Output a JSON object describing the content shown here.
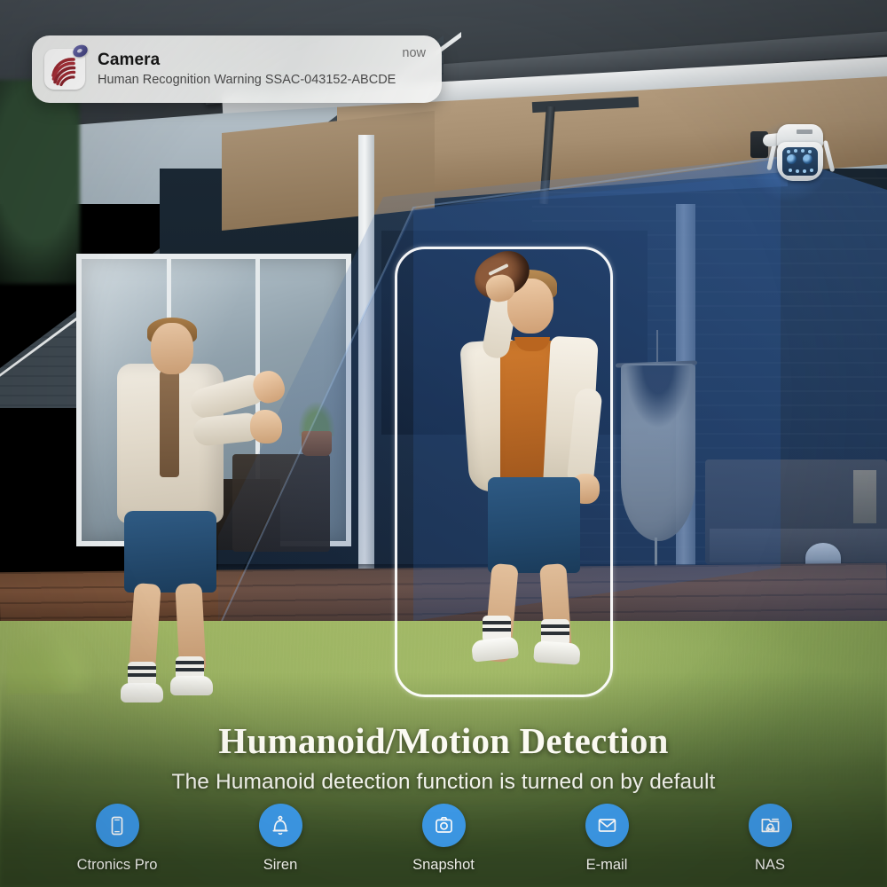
{
  "notification": {
    "app_icon": "camera-app-icon",
    "badge_icon": "shield-badge-icon",
    "title": "Camera",
    "message": "Human Recognition Warning SSAC-043152-ABCDE",
    "time": "now"
  },
  "scene": {
    "camera_device": "ptz-security-camera",
    "detection_box": "humanoid-detection-bounding-box",
    "detection_cone": "camera-field-of-view-cone",
    "subject_left": "person-catching",
    "subject_right": "person-throwing-football"
  },
  "headline": {
    "title": "Humanoid/Motion Detection",
    "subtitle": "The Humanoid detection function is turned on by default"
  },
  "features": [
    {
      "label": "Ctronics Pro",
      "icon": "smartphone-icon"
    },
    {
      "label": "Siren",
      "icon": "bell-icon"
    },
    {
      "label": "Snapshot",
      "icon": "camera-icon"
    },
    {
      "label": "E-mail",
      "icon": "envelope-icon"
    },
    {
      "label": "NAS",
      "icon": "nas-folder-icon"
    }
  ],
  "colors": {
    "accent_blue": "#3d9ae8",
    "detection_box_stroke": "#ffffff",
    "cone_blue": "#2e5fa8",
    "headline_text": "#fbfaf2",
    "notification_bg": "#f2f2f1"
  }
}
